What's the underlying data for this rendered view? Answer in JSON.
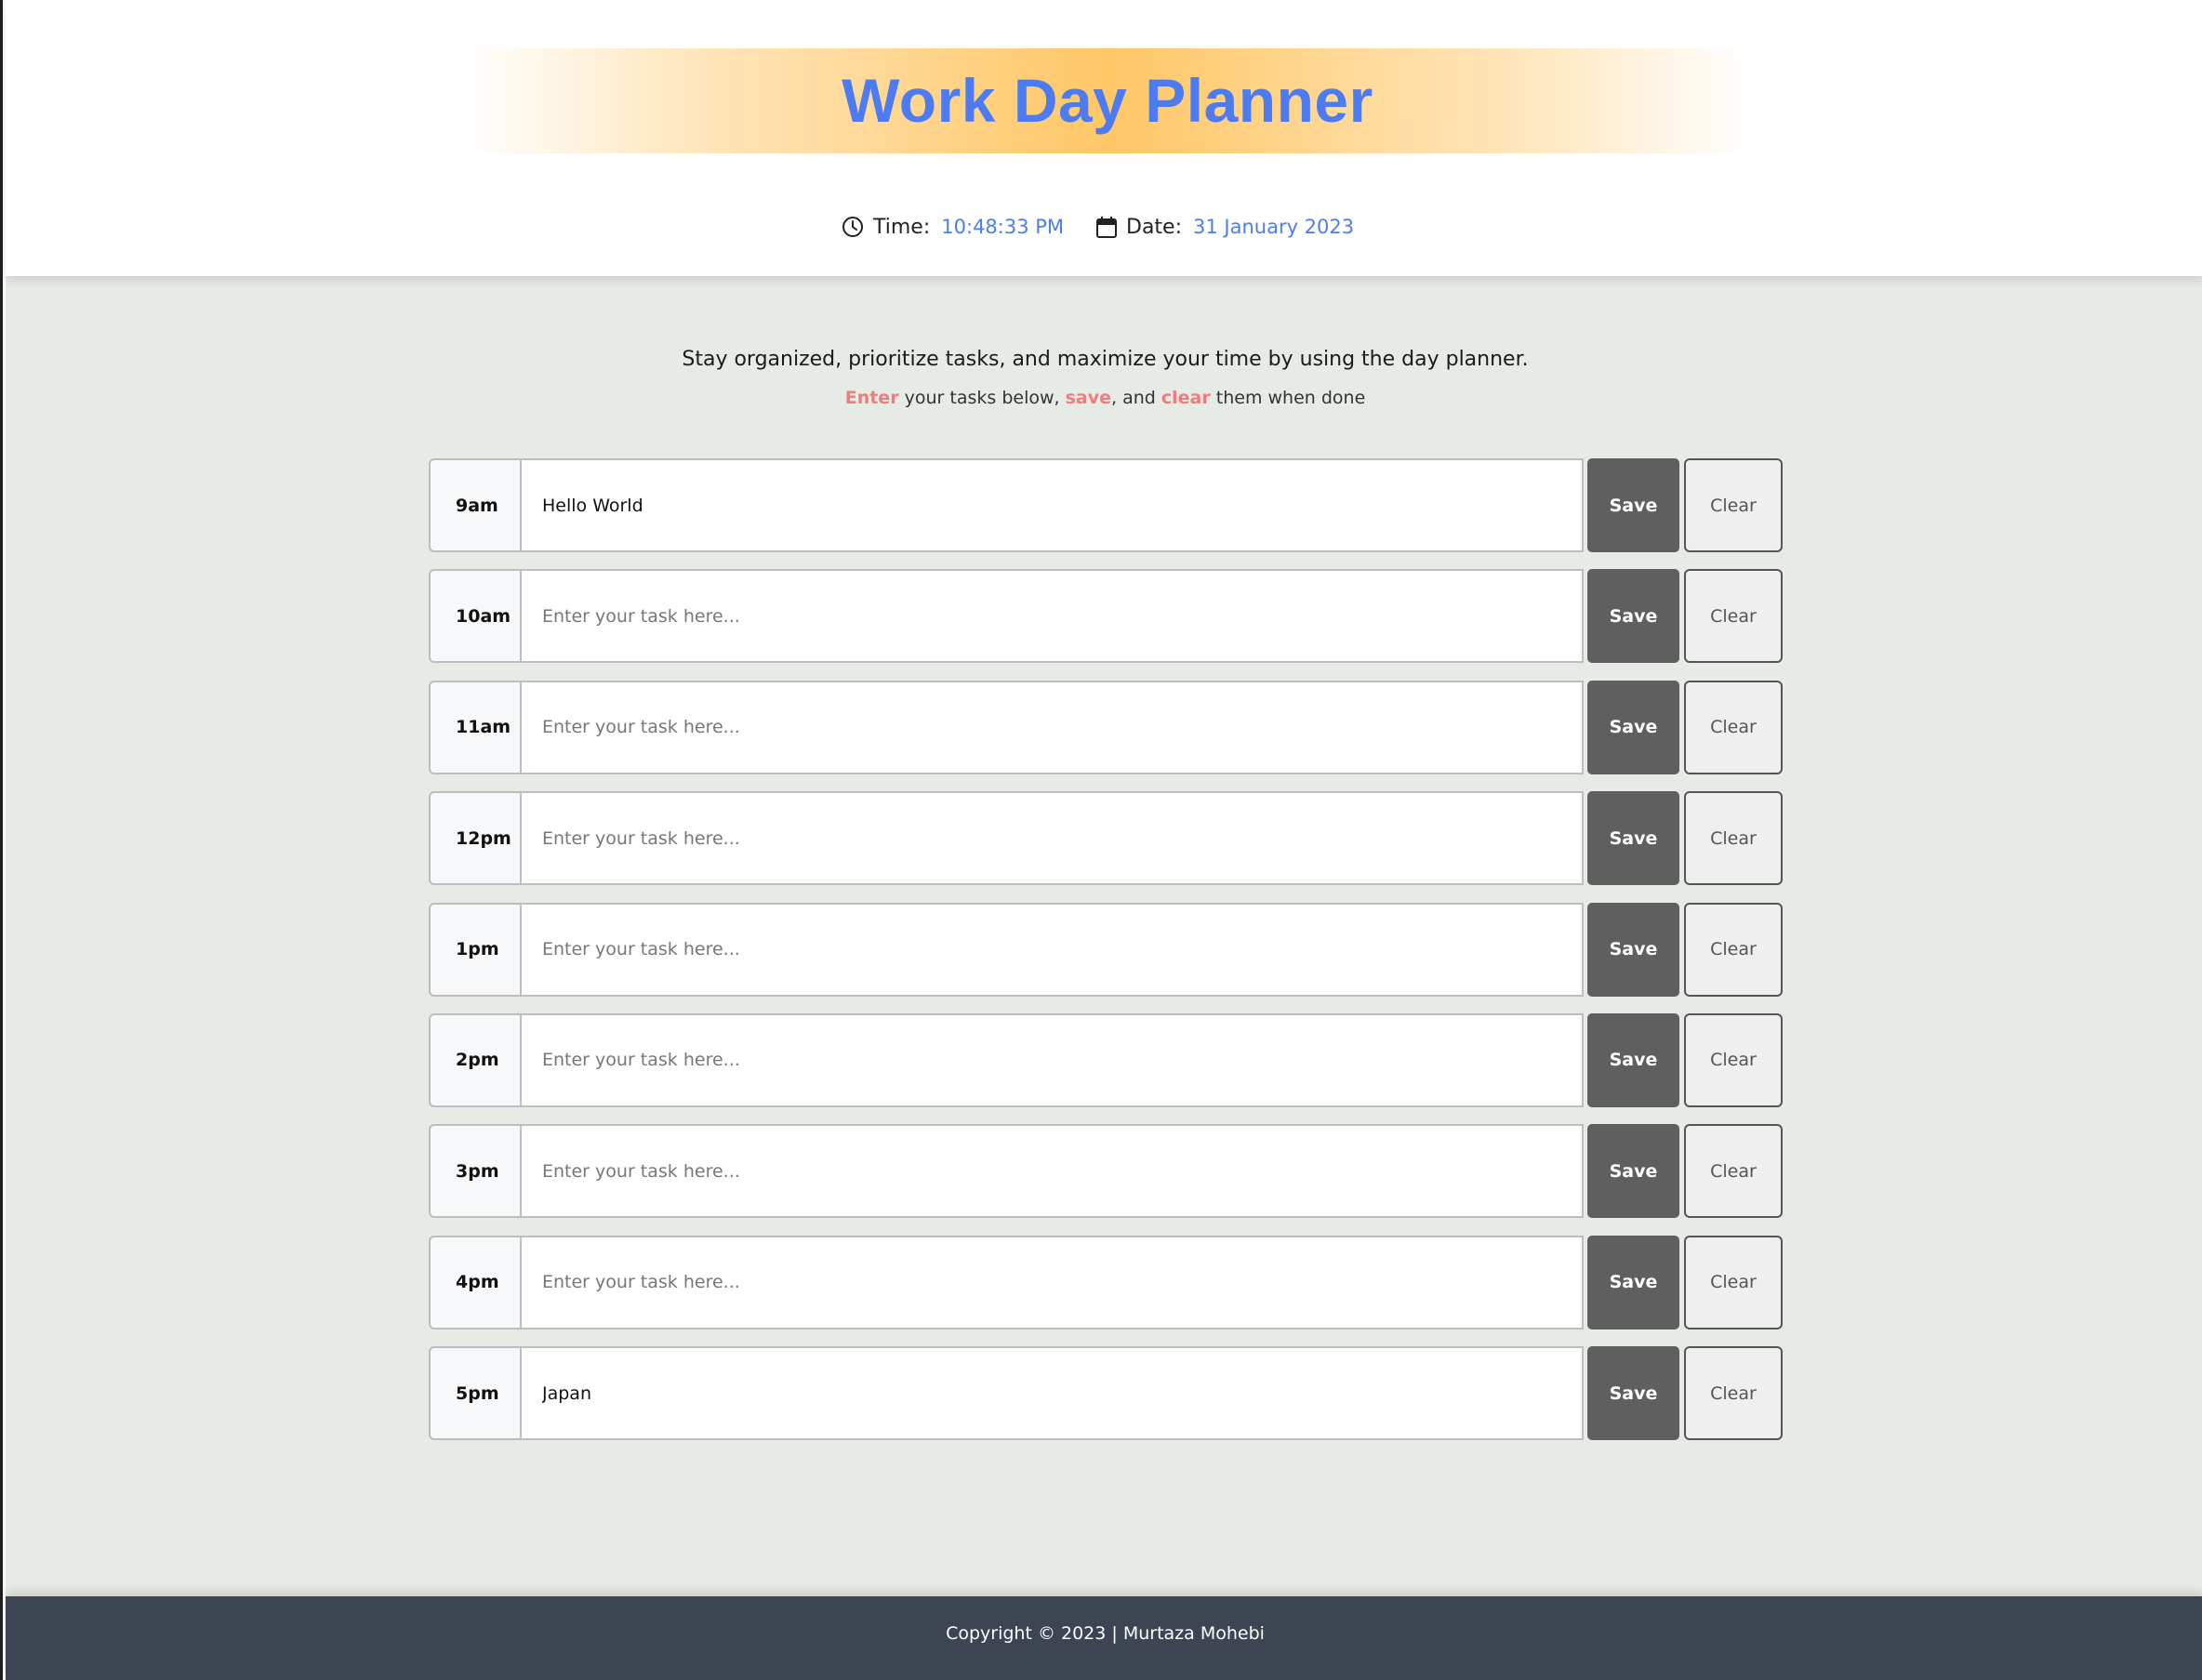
{
  "header": {
    "title": "Work Day Planner",
    "time_label": "Time:",
    "time_value": "10:48:33 PM",
    "date_label": "Date:",
    "date_value": "31 January 2023"
  },
  "intro": {
    "line1": "Stay organized, prioritize tasks, and maximize your time by using the day planner.",
    "enter": "Enter",
    "part1": " your tasks below, ",
    "save": "save",
    "part2": ", and ",
    "clear": "clear",
    "part3": " them when done"
  },
  "rows": [
    {
      "hour": "9am",
      "task": "Hello World",
      "save_label": "Save",
      "clear_label": "Clear"
    },
    {
      "hour": "10am",
      "task": "",
      "save_label": "Save",
      "clear_label": "Clear"
    },
    {
      "hour": "11am",
      "task": "",
      "save_label": "Save",
      "clear_label": "Clear"
    },
    {
      "hour": "12pm",
      "task": "",
      "save_label": "Save",
      "clear_label": "Clear"
    },
    {
      "hour": "1pm",
      "task": "",
      "save_label": "Save",
      "clear_label": "Clear"
    },
    {
      "hour": "2pm",
      "task": "",
      "save_label": "Save",
      "clear_label": "Clear"
    },
    {
      "hour": "3pm",
      "task": "",
      "save_label": "Save",
      "clear_label": "Clear"
    },
    {
      "hour": "4pm",
      "task": "",
      "save_label": "Save",
      "clear_label": "Clear"
    },
    {
      "hour": "5pm",
      "task": "Japan",
      "save_label": "Save",
      "clear_label": "Clear"
    }
  ],
  "task_placeholder": "Enter your task here...",
  "footer": {
    "copyright": "Copyright © 2023 | Murtaza Mohebi"
  },
  "colors": {
    "accent": "#4d7cf2",
    "highlight": "#f07c7c",
    "title_band": "#ffc766",
    "main_bg": "#e6ebe6",
    "footer_bg": "#3d4452",
    "save_bg": "#5f5f5f"
  },
  "icons": {
    "time": "clock-icon",
    "date": "calendar-icon"
  }
}
